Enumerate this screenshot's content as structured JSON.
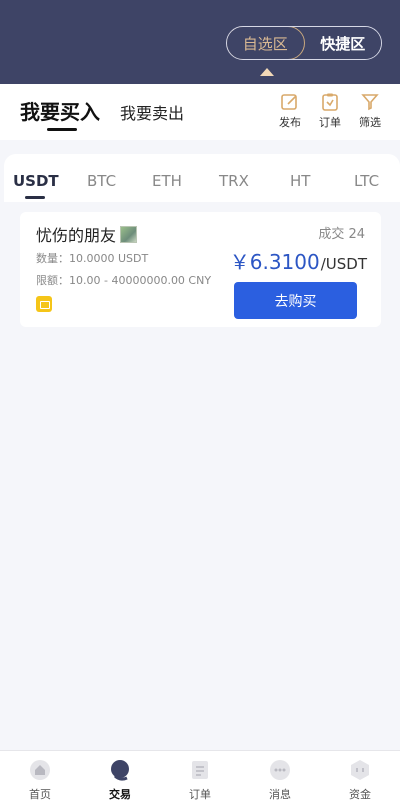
{
  "header": {
    "zone_left": "自选区",
    "zone_right": "快捷区"
  },
  "subhead": {
    "buy_tab": "我要买入",
    "sell_tab": "我要卖出",
    "tools": [
      {
        "label": "发布",
        "icon": "edit-icon"
      },
      {
        "label": "订单",
        "icon": "clipboard-icon"
      },
      {
        "label": "筛选",
        "icon": "filter-icon"
      }
    ]
  },
  "coins": [
    "USDT",
    "BTC",
    "ETH",
    "TRX",
    "HT",
    "LTC"
  ],
  "active_coin": "USDT",
  "listing": {
    "merchant": "忧伤的朋友",
    "deals": "成交 24",
    "quantity": "数量：10.0000 USDT",
    "limit": "限额：10.00 - 40000000.00 CNY",
    "price": "￥6.3100",
    "price_unit": "/USDT",
    "buy_button": "去购买",
    "payment_icon": "wallet-icon"
  },
  "bottom_nav": [
    {
      "label": "首页",
      "icon": "home-icon"
    },
    {
      "label": "交易",
      "icon": "trade-icon",
      "active": true
    },
    {
      "label": "订单",
      "icon": "order-icon"
    },
    {
      "label": "消息",
      "icon": "message-icon"
    },
    {
      "label": "资金",
      "icon": "wallet-icon"
    }
  ],
  "colors": {
    "header_bg": "#3e4466",
    "accent_blue": "#2b5fe0",
    "price_blue": "#2c56c4",
    "gold": "#d9b993"
  }
}
